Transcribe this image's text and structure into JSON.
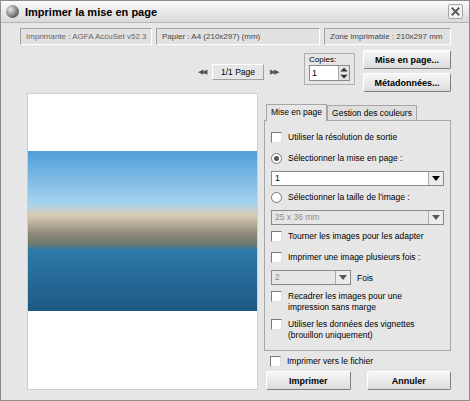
{
  "window": {
    "title": "Imprimer la mise en page"
  },
  "info": [
    "Imprimante : AGFA AccuSet v52.3",
    "Papier : A4 (210x297) (mm)",
    "Zone imprimable : 210x297 mm"
  ],
  "pager": {
    "prev": "◀◀",
    "page": "1/1 Page",
    "next": "▶▶"
  },
  "copies": {
    "label": "Copies:",
    "value": "1"
  },
  "side_buttons": [
    "Mise en page...",
    "Métadonnées..."
  ],
  "tabs": [
    {
      "label": "Mise en page",
      "selected": true
    },
    {
      "label": "Gestion des couleurs",
      "selected": false
    }
  ],
  "options": [
    {
      "kind": "checkbox",
      "label": "Utiliser la résolution de sortie",
      "checked": false
    },
    {
      "kind": "radio",
      "label": "Sélectionner la mise en page :",
      "selected": true
    },
    {
      "kind": "select",
      "value": "1",
      "disabled": false
    },
    {
      "kind": "radio",
      "label": "Sélectionner la taille de l'image :",
      "selected": false
    },
    {
      "kind": "select",
      "value": "25 x 36 mm",
      "disabled": true
    },
    {
      "kind": "checkbox",
      "label": "Tourner les images pour les adapter",
      "checked": false
    },
    {
      "kind": "checkbox",
      "label": "Imprimer une image plusieurs fois :",
      "checked": false
    },
    {
      "kind": "select",
      "value": "2",
      "disabled": true,
      "suffix": "Fois"
    },
    {
      "kind": "checkbox",
      "label": "Recadrer les images pour une impression sans marge",
      "checked": false
    },
    {
      "kind": "checkbox",
      "label": "Utiliser les données des vignettes (brouillon uniquement)",
      "checked": false
    }
  ],
  "print_to_file": {
    "label": "Imprimer vers le fichier",
    "checked": false
  },
  "buttons": [
    "Imprimer",
    "Annuler"
  ]
}
